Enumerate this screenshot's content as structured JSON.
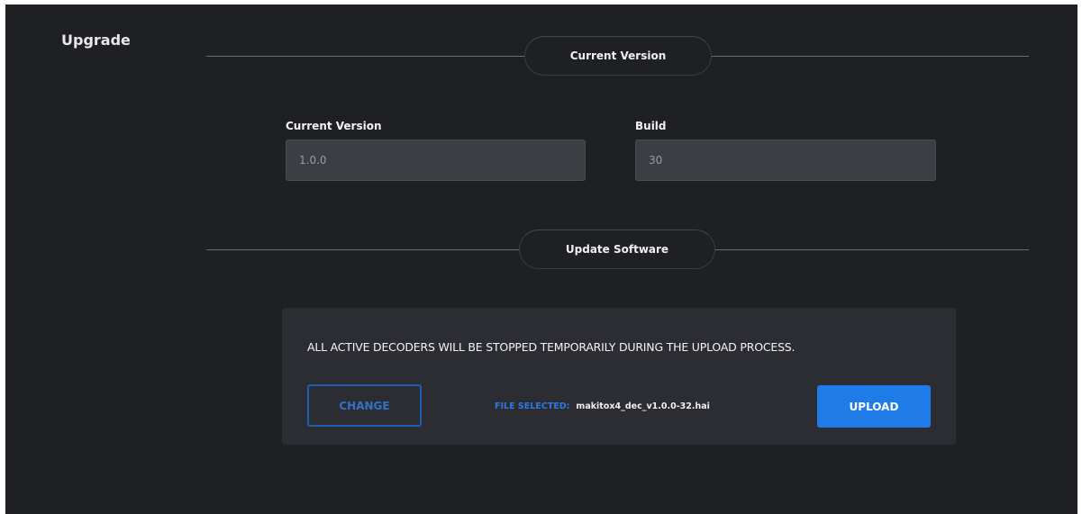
{
  "page": {
    "title": "Upgrade"
  },
  "current_version_section": {
    "heading": "Current Version",
    "version_label": "Current Version",
    "version_value": "1.0.0",
    "build_label": "Build",
    "build_value": "30"
  },
  "update_section": {
    "heading": "Update Software",
    "warning": "ALL ACTIVE DECODERS WILL BE STOPPED TEMPORARILY DURING THE UPLOAD PROCESS.",
    "change_label": "CHANGE",
    "file_selected_label": "FILE SELECTED:",
    "file_name": "makitox4_dec_v1.0.0-32.hai",
    "upload_label": "UPLOAD"
  },
  "colors": {
    "background": "#1f2024",
    "accent": "#1f7be8",
    "input_bg": "#3d3e44"
  }
}
